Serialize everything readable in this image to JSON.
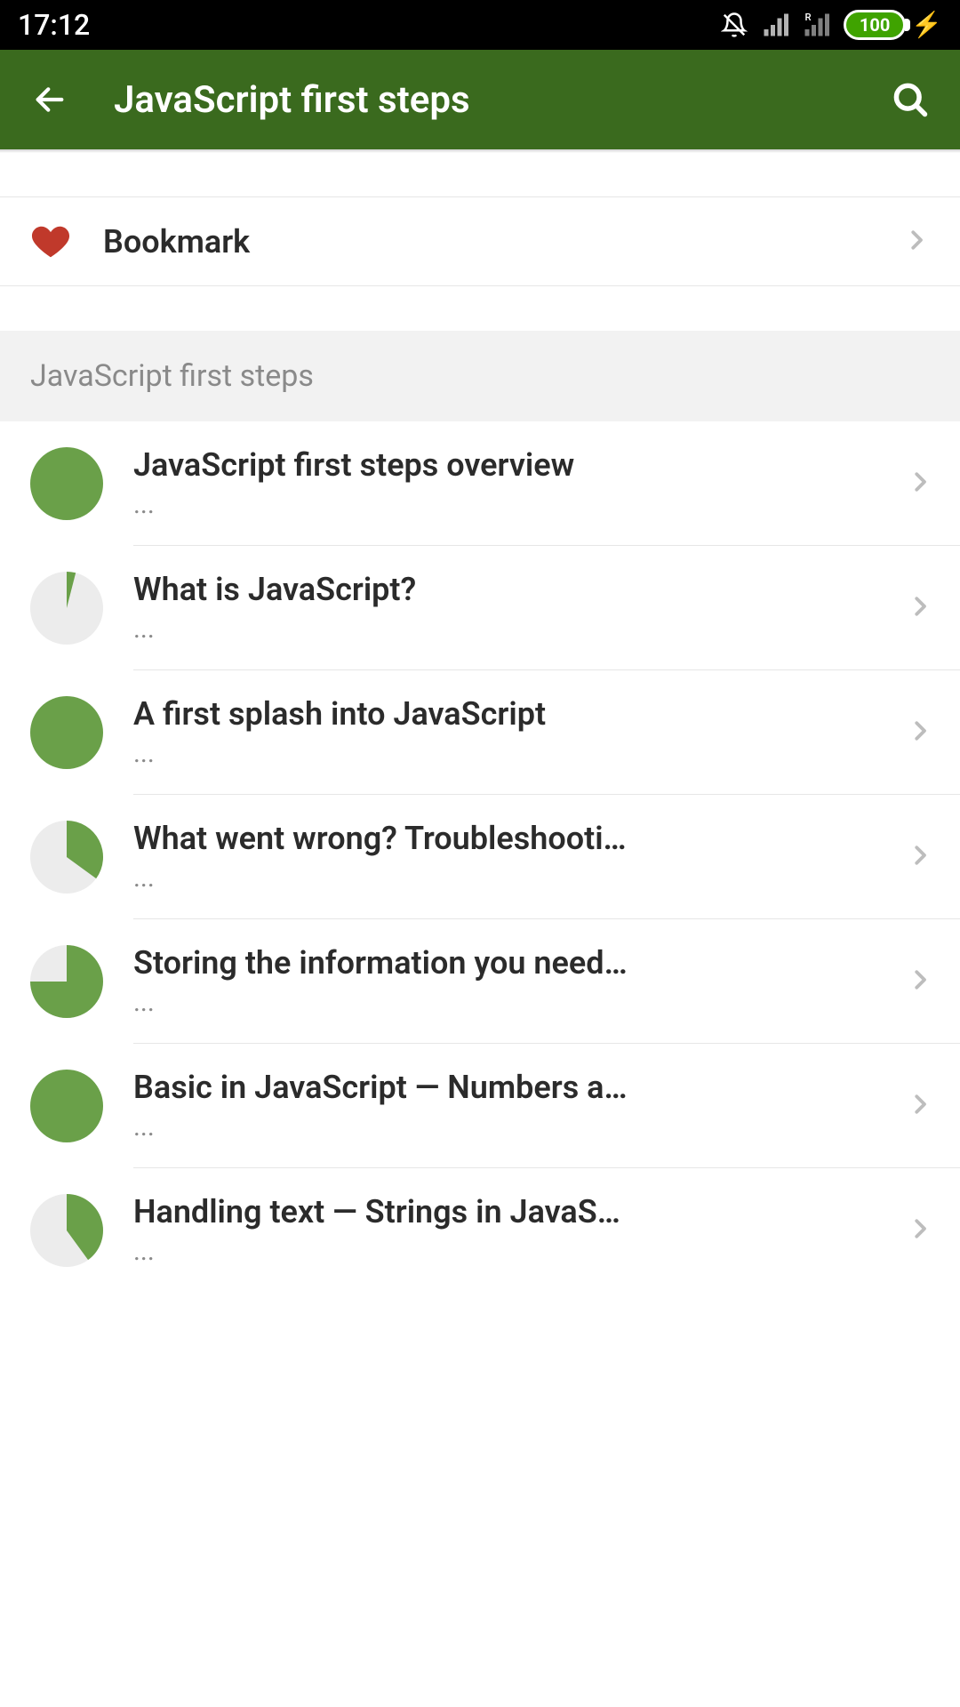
{
  "status_bar": {
    "time": "17:12",
    "battery_text": "100"
  },
  "app_bar": {
    "title": "JavaScript first steps"
  },
  "bookmark": {
    "label": "Bookmark"
  },
  "section": {
    "title": "JavaScript first steps"
  },
  "colors": {
    "accent": "#6aa049",
    "heart": "#c0392b"
  },
  "items": [
    {
      "title": "JavaScript first steps overview",
      "sub": "...",
      "progress": 100
    },
    {
      "title": "What is JavaScript?",
      "sub": "...",
      "progress": 4
    },
    {
      "title": "A first splash into JavaScript",
      "sub": "...",
      "progress": 100
    },
    {
      "title": "What went wrong? Troubleshooting Ja…",
      "sub": "...",
      "progress": 35
    },
    {
      "title": "Storing the information you need — Va…",
      "sub": "...",
      "progress": 75
    },
    {
      "title": "Basic in JavaScript — Numbers and op…",
      "sub": "...",
      "progress": 100
    },
    {
      "title": "Handling text — Strings in JavaScript",
      "sub": "...",
      "progress": 40
    }
  ]
}
